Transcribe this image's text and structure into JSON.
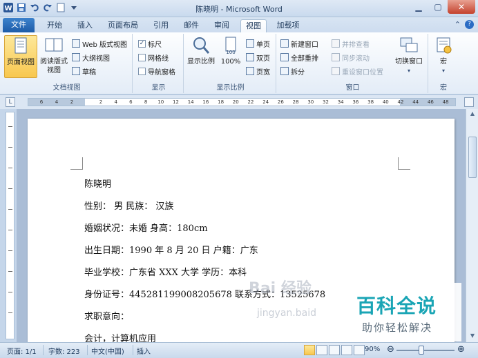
{
  "window": {
    "title": "陈晓明 - Microsoft Word"
  },
  "tabs": {
    "file": "文件",
    "items": [
      "开始",
      "插入",
      "页面布局",
      "引用",
      "邮件",
      "审阅",
      "视图",
      "加载项"
    ],
    "active": "视图"
  },
  "ribbon": {
    "doc_views": {
      "label": "文档视图",
      "print_layout": "页面视图",
      "full_screen_reading": "阅读版式视图",
      "web_layout": "Web 版式视图",
      "outline": "大纲视图",
      "draft": "草稿"
    },
    "show": {
      "label": "显示",
      "ruler": "标尺",
      "gridlines": "网格线",
      "nav_pane": "导航窗格",
      "ruler_checked": true
    },
    "zoom": {
      "label": "显示比例",
      "zoom_btn": "显示比例",
      "hundred": "100%",
      "one_page": "单页",
      "two_pages": "双页",
      "page_width": "页宽"
    },
    "window_grp": {
      "label": "窗口",
      "new_window": "新建窗口",
      "arrange_all": "全部重排",
      "split": "拆分",
      "side_by_side": "并排查看",
      "sync_scroll": "同步滚动",
      "reset_pos": "重设窗口位置",
      "switch_windows": "切换窗口"
    },
    "macros": {
      "label": "宏",
      "btn": "宏"
    }
  },
  "ruler": {
    "left_ticks": [
      "6",
      "4",
      "2"
    ],
    "ticks": [
      "2",
      "4",
      "6",
      "8",
      "10",
      "12",
      "14",
      "16",
      "18",
      "20",
      "22",
      "24",
      "26",
      "28",
      "30",
      "32",
      "34",
      "36",
      "38",
      "40",
      "42",
      "44",
      "46",
      "48"
    ]
  },
  "document": {
    "lines": [
      {
        "name": "name-line",
        "text": "陈晓明"
      },
      {
        "name": "gender-line",
        "text": "性别：          男                    民族：          汉族"
      },
      {
        "name": "marital-line",
        "text": "婚姻状况：未婚  身高：180cm"
      },
      {
        "name": "birth-line",
        "text": "出生日期：1990 年 8 月 20 日  户籍：广东"
      },
      {
        "name": "school-line",
        "text": "毕业学校：广东省 XXX 大学  学历：本科"
      },
      {
        "name": "id-line",
        "text": "身份证号：445281199008205678   联系方式：13525678"
      },
      {
        "name": "intent-line",
        "text": "求职意向："
      },
      {
        "name": "job-line",
        "text": "会计，计算机应用"
      }
    ]
  },
  "status": {
    "page": "页面: 1/1",
    "words": "字数: 223",
    "lang": "中文(中国)",
    "mode": "插入",
    "zoom": "90%"
  },
  "watermark": {
    "big": "百科全说",
    "small": "助你轻松解决",
    "faint": "Bai 经验",
    "faint_url": "jingyan.baid"
  }
}
